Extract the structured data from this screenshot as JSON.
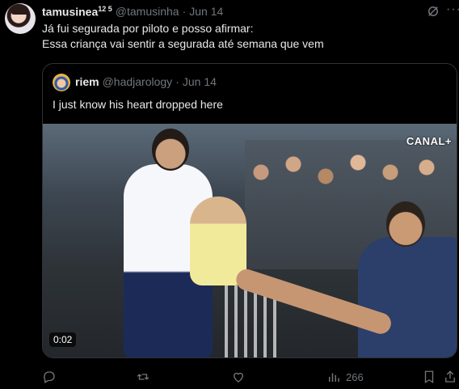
{
  "tweet": {
    "author_name": "tamusinea",
    "author_sup": "12 5",
    "handle": "@tamusinha",
    "separator": "·",
    "date": "Jun 14",
    "text": "Já fui segurada por piloto e posso afirmar:\nEssa criança vai sentir a segurada até semana que vem"
  },
  "quote": {
    "author_name": "riem",
    "handle": "@hadjarology",
    "separator": "·",
    "date": "Jun 14",
    "text": "I just know his heart dropped here",
    "video": {
      "watermark": "CANAL+",
      "duration": "0:02"
    }
  },
  "actions": {
    "reply_count": "",
    "retweet_count": "",
    "like_count": "",
    "views_count": "266"
  },
  "icons": [
    "grok-icon",
    "more-icon",
    "reply-icon",
    "retweet-icon",
    "like-icon",
    "views-icon",
    "bookmark-icon",
    "share-icon"
  ]
}
